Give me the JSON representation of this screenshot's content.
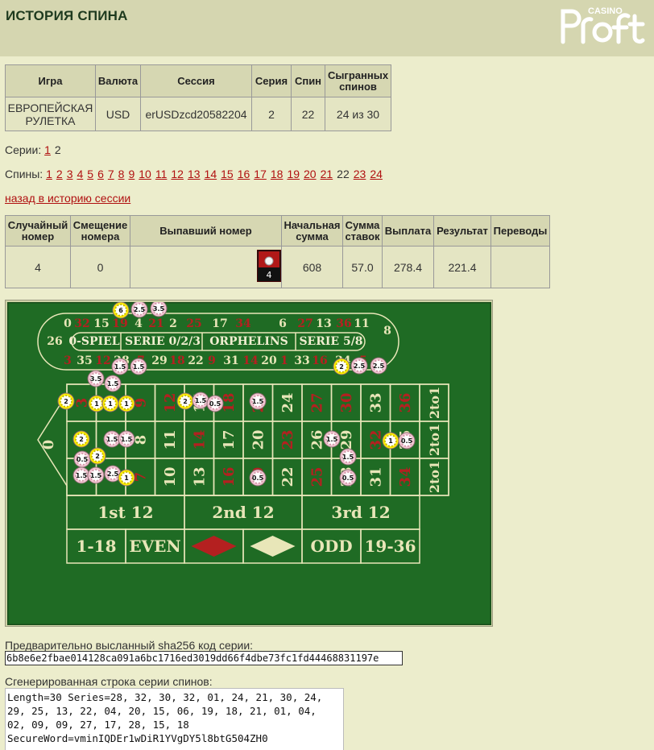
{
  "page": {
    "title": "ИСТОРИЯ СПИНА",
    "logo_small": "CASINO",
    "logo_big": "Profit"
  },
  "session_table": {
    "headers": [
      "Игра",
      "Валюта",
      "Сессия",
      "Серия",
      "Спин",
      "Сыгранных спинов"
    ],
    "values": [
      "ЕВРОПЕЙСКАЯ РУЛЕТКА",
      "USD",
      "erUSDzcd20582204",
      "2",
      "22",
      "24 из 30"
    ]
  },
  "series_nav": {
    "label": "Серии:",
    "links": [
      "1"
    ],
    "current": "2"
  },
  "spins_nav": {
    "label": "Спины:",
    "before": [
      "1",
      "2",
      "3",
      "4",
      "5",
      "6",
      "7",
      "8",
      "9",
      "10",
      "11",
      "12",
      "13",
      "14",
      "15",
      "16",
      "17",
      "18",
      "19",
      "20",
      "21"
    ],
    "current": "22",
    "after": [
      "23",
      "24"
    ]
  },
  "back_link": "назад в историю сессии",
  "spin_table": {
    "headers": [
      "Случайный номер",
      "Смещение номера",
      "Выпавший номер",
      "Начальная сумма",
      "Сумма ставок",
      "Выплата",
      "Результат",
      "Переводы"
    ],
    "random_number": "4",
    "offset": "0",
    "result_number": "4",
    "start_sum": "608",
    "bets_sum": "57.0",
    "payout": "278.4",
    "result": "221.4",
    "transfers": ""
  },
  "racetrack": {
    "top_numbers": [
      "0",
      "32",
      "15",
      "19",
      "4",
      "21",
      "2",
      "25",
      "17",
      "34",
      "6",
      "27",
      "13",
      "36",
      "11"
    ],
    "bottom_numbers": [
      "3",
      "35",
      "12",
      "28",
      "7",
      "29",
      "18",
      "22",
      "9",
      "31",
      "14",
      "20",
      "1",
      "33",
      "16",
      "24",
      "5",
      "10",
      "23"
    ],
    "left_number": "26",
    "right_numbers": [
      "30",
      "8"
    ],
    "sections": [
      "0-SPIEL",
      "SERIE 0/2/3",
      "ORPHELINS",
      "SERIE 5/8"
    ]
  },
  "table_layout": {
    "zero": "0",
    "rows": [
      [
        "3",
        "6",
        "9",
        "12",
        "15",
        "18",
        "21",
        "24",
        "27",
        "30",
        "33",
        "36"
      ],
      [
        "2",
        "5",
        "8",
        "11",
        "14",
        "17",
        "20",
        "23",
        "26",
        "29",
        "32",
        "35"
      ],
      [
        "1",
        "4",
        "7",
        "10",
        "13",
        "16",
        "19",
        "22",
        "25",
        "28",
        "31",
        "34"
      ]
    ],
    "columns": [
      "2to1",
      "2to1",
      "2to1"
    ],
    "dozens": [
      "1st 12",
      "2nd 12",
      "3rd 12"
    ],
    "outside": [
      "1-18",
      "EVEN",
      "ODD",
      "19-36"
    ]
  },
  "chips": [
    {
      "value": "6"
    },
    {
      "value": "2.5"
    },
    {
      "value": "3.5"
    },
    {
      "value": "1.5"
    },
    {
      "value": "1.5"
    },
    {
      "value": "2"
    },
    {
      "value": "2.5"
    },
    {
      "value": "2.5"
    },
    {
      "value": "3.5"
    },
    {
      "value": "1.5"
    },
    {
      "value": "2"
    },
    {
      "value": "1"
    },
    {
      "value": "1"
    },
    {
      "value": "1"
    },
    {
      "value": "2"
    },
    {
      "value": "1.5"
    },
    {
      "value": "0.5"
    },
    {
      "value": "1.5"
    },
    {
      "value": "2"
    },
    {
      "value": "1.5"
    },
    {
      "value": "1.5"
    },
    {
      "value": "1.5"
    },
    {
      "value": "1"
    },
    {
      "value": "0.5"
    },
    {
      "value": "0.5"
    },
    {
      "value": "2"
    },
    {
      "value": "1.5"
    },
    {
      "value": "1.5"
    },
    {
      "value": "1.5"
    },
    {
      "value": "2.5"
    },
    {
      "value": "1"
    },
    {
      "value": "0.5"
    },
    {
      "value": "0.5"
    }
  ],
  "hash": {
    "label": "Предварительно высланный sha256 код серии:",
    "value": "6b8e6e2fbae014128ca091a6bc1716ed3019dd66f4dbe73fc1fd44468831197e"
  },
  "generated": {
    "label": "Сгенерированная строка серии спинов:",
    "value": "Length=30 Series=28, 32, 30, 32, 01, 24, 21, 30, 24,\n29, 25, 13, 22, 04, 20, 15, 06, 19, 18, 21, 01, 04,\n02, 09, 09, 27, 17, 28, 15, 18\nSecureWord=vminIQDEr1wDiR1YVgDY5l8btG504ZH0"
  },
  "colors": {
    "felt": "#1f6b24",
    "red": "#b42020",
    "black": "#111111",
    "link": "#b01010",
    "chip_pink": "#f3c7d4",
    "chip_yellow": "#fff000"
  }
}
